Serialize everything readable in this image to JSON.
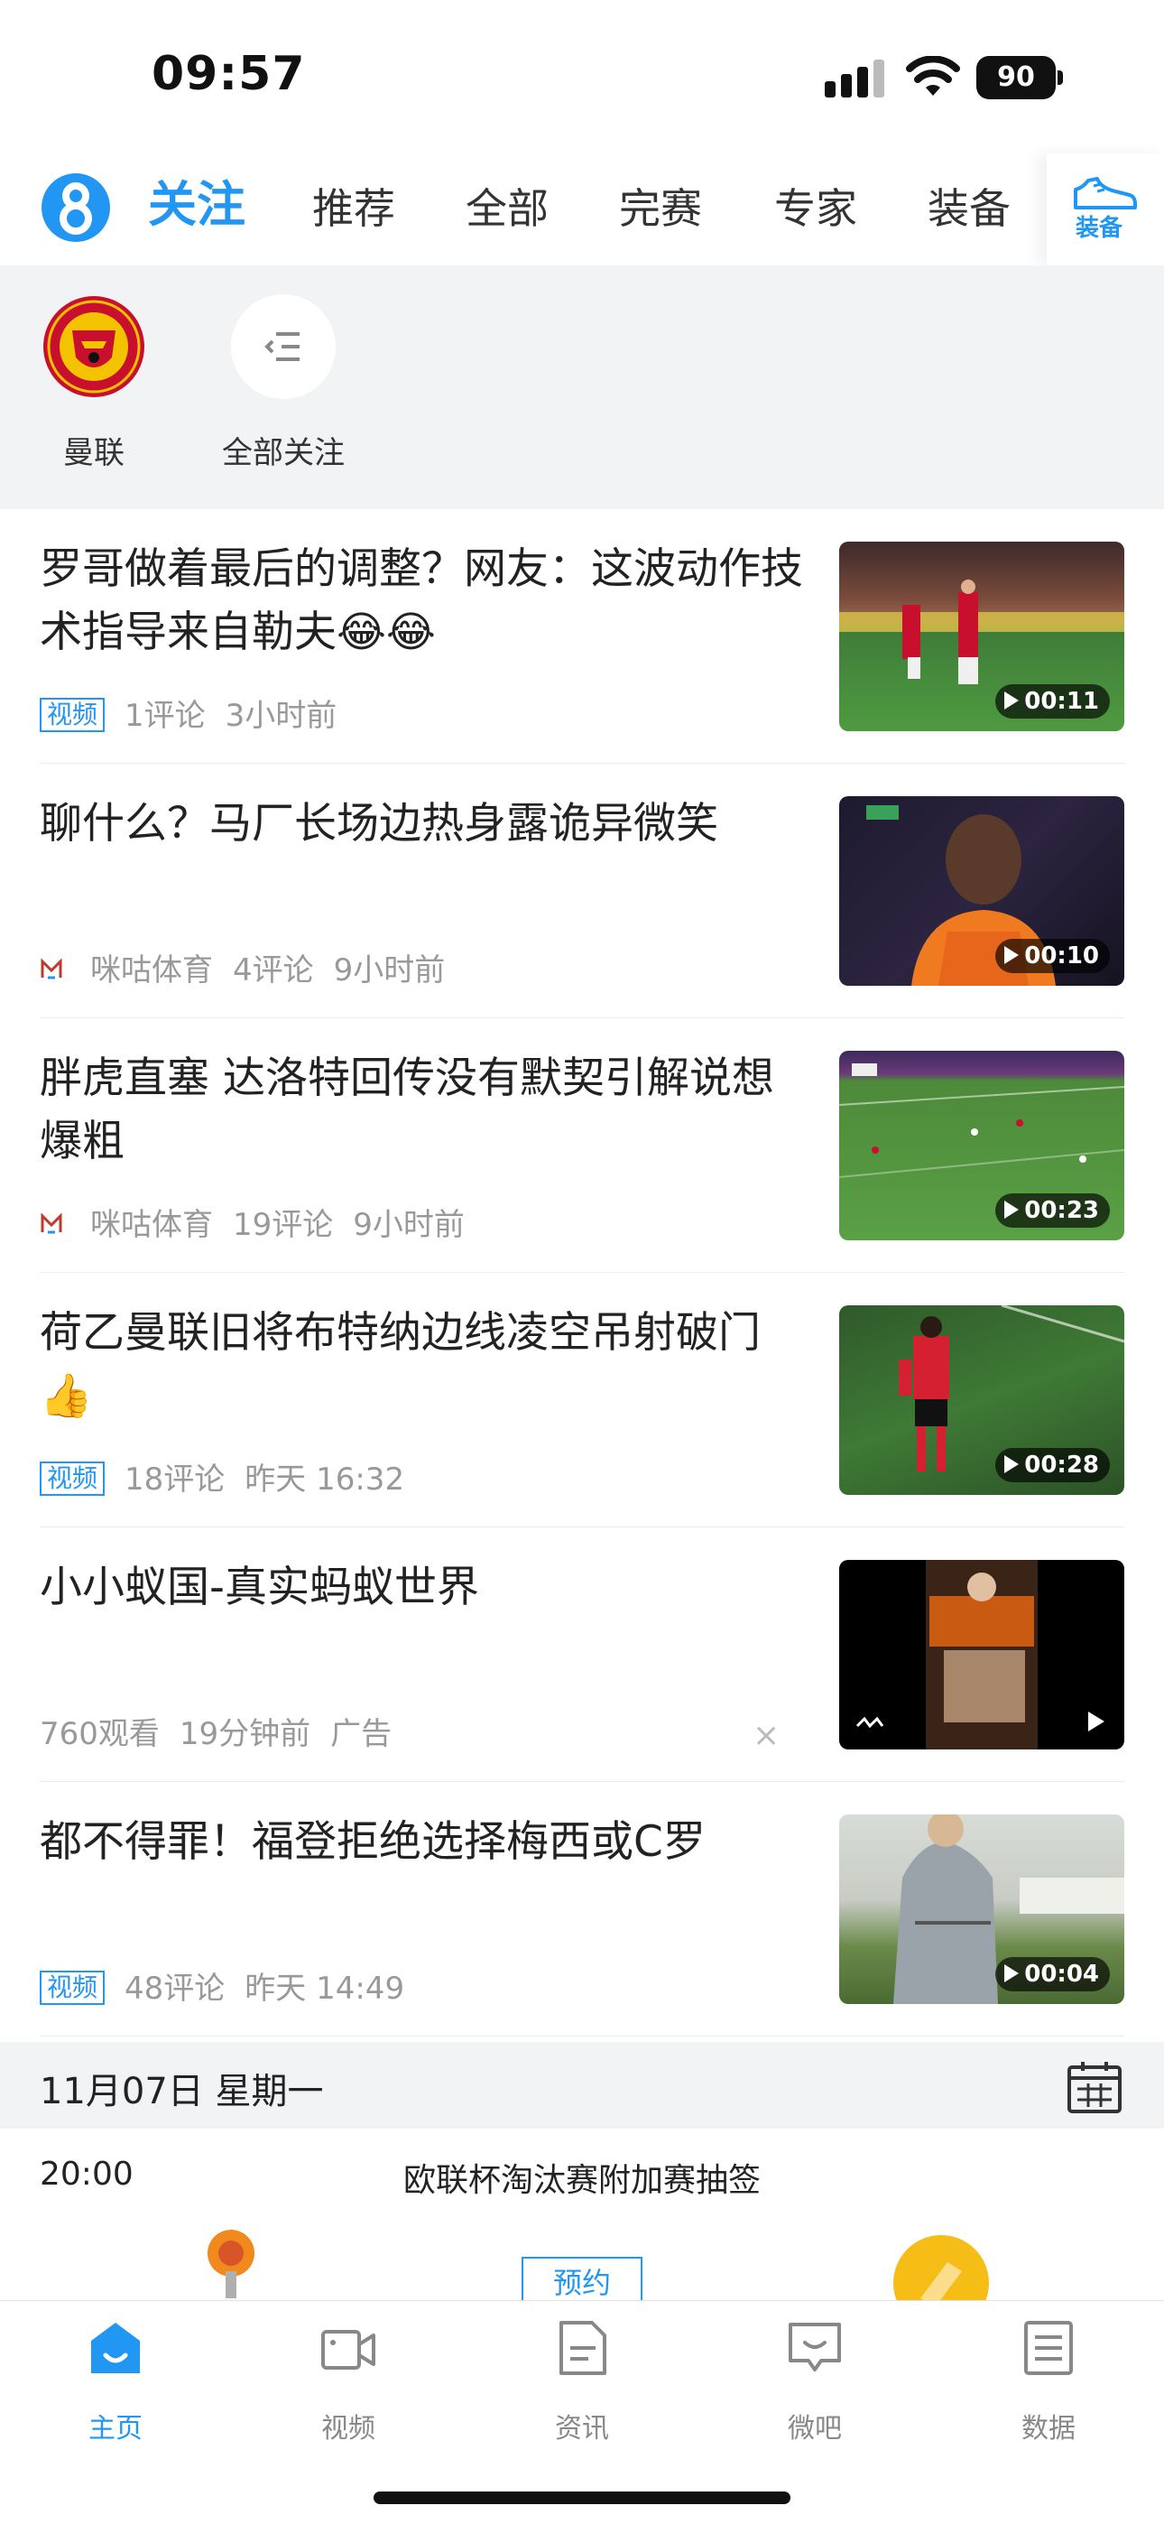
{
  "status_bar": {
    "time": "09:57",
    "battery": "90"
  },
  "top_nav": {
    "tabs": [
      {
        "label": "关注",
        "active": true
      },
      {
        "label": "推荐"
      },
      {
        "label": "全部"
      },
      {
        "label": "完赛"
      },
      {
        "label": "专家"
      },
      {
        "label": "装备"
      }
    ],
    "gear_button_label": "装备"
  },
  "follow_strip": {
    "items": [
      {
        "label": "曼联",
        "icon": "man-utd-crest"
      },
      {
        "label": "全部关注",
        "icon": "list-icon"
      }
    ]
  },
  "feed": [
    {
      "title": "罗哥做着最后的调整？网友：这波动作技术指导来自勒夫😂😂",
      "tag": "视频",
      "comments": "1评论",
      "time": "3小时前",
      "duration": "00:11"
    },
    {
      "title": "聊什么？马厂长场边热身露诡异微笑",
      "source": "咪咕体育",
      "comments": "4评论",
      "time": "9小时前",
      "duration": "00:10"
    },
    {
      "title": "胖虎直塞 达洛特回传没有默契引解说想爆粗",
      "source": "咪咕体育",
      "comments": "19评论",
      "time": "9小时前",
      "duration": "00:23"
    },
    {
      "title": "荷乙曼联旧将布特纳边线凌空吊射破门👍",
      "tag": "视频",
      "comments": "18评论",
      "time": "昨天 16:32",
      "duration": "00:28"
    },
    {
      "title": "小小蚁国-真实蚂蚁世界",
      "views": "760观看",
      "time": "19分钟前",
      "ad_label": "广告",
      "close": "×"
    },
    {
      "title": "都不得罪！福登拒绝选择梅西或C罗",
      "tag": "视频",
      "comments": "48评论",
      "time": "昨天 14:49",
      "duration": "00:04"
    }
  ],
  "schedule": {
    "date": "11月07日 星期一",
    "match": {
      "time": "20:00",
      "title": "欧联杯淘汰赛附加赛抽签",
      "reserve_label": "预约"
    }
  },
  "tab_bar": {
    "items": [
      {
        "label": "主页",
        "icon": "home-icon",
        "active": true
      },
      {
        "label": "视频",
        "icon": "video-camera-icon"
      },
      {
        "label": "资讯",
        "icon": "document-icon"
      },
      {
        "label": "微吧",
        "icon": "chat-bubble-icon"
      },
      {
        "label": "数据",
        "icon": "list-icon"
      }
    ]
  },
  "colors": {
    "accent": "#2196f3",
    "background_gray": "#f2f3f5",
    "meta_text": "#999999"
  }
}
